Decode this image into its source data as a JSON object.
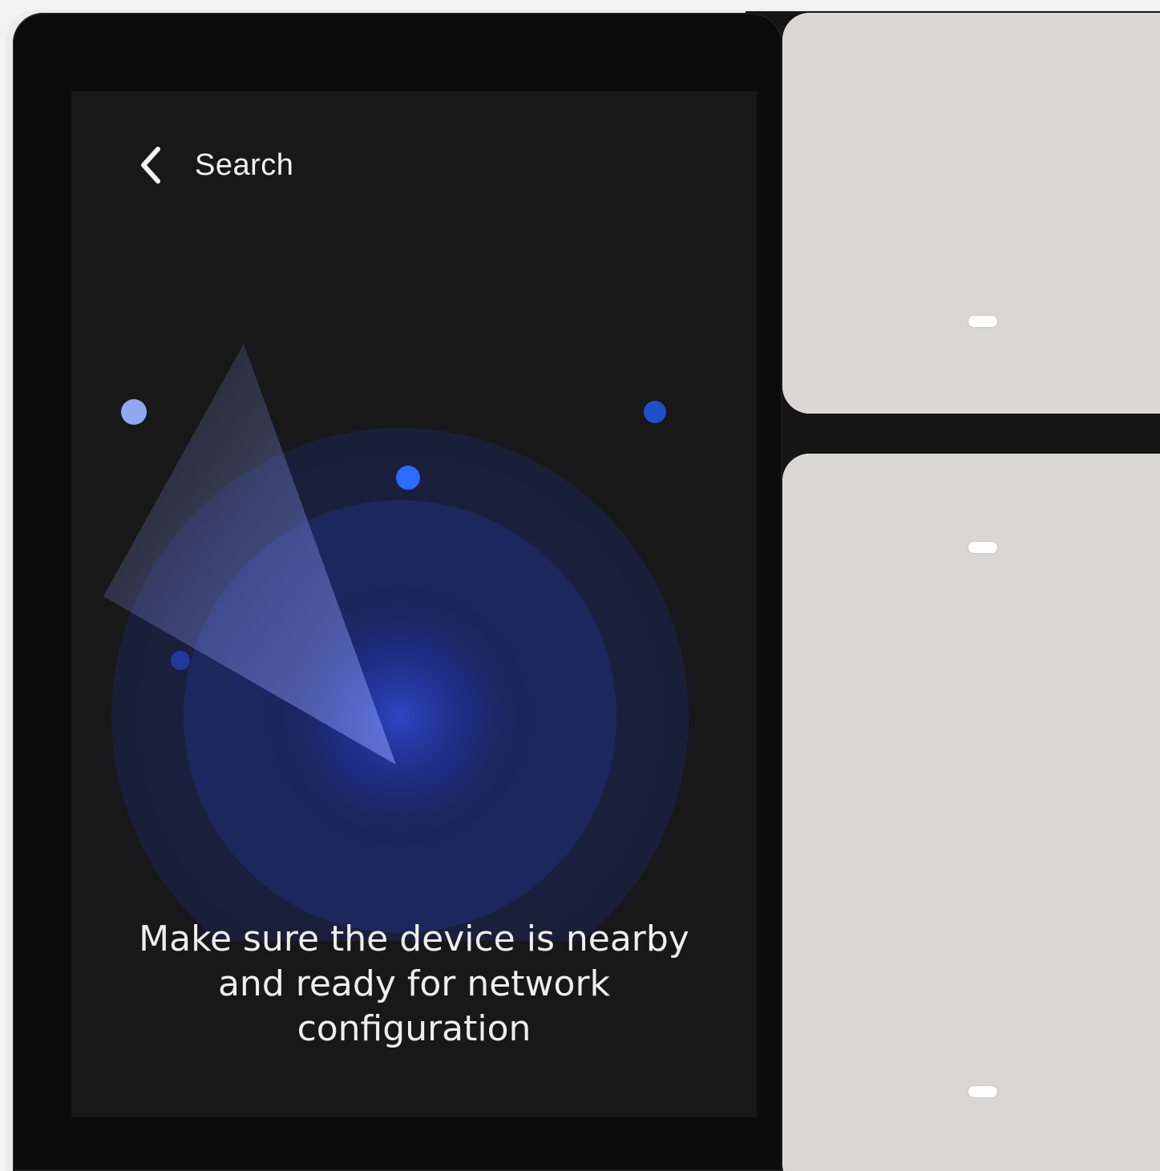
{
  "screen": {
    "header": {
      "back_icon": "chevron-left-icon",
      "title": "Search"
    },
    "message_lines": [
      "Make sure the device is nearby",
      "and ready for network",
      "configuration"
    ]
  },
  "colors": {
    "screen_background": "#181818",
    "radar_blue": "#2f5bff",
    "text": "#eeeeee",
    "switch_panel": "#d8d7d4"
  },
  "switch_keys": [
    {
      "indicator": "indicator-light"
    },
    {
      "indicator": "indicator-light"
    }
  ]
}
